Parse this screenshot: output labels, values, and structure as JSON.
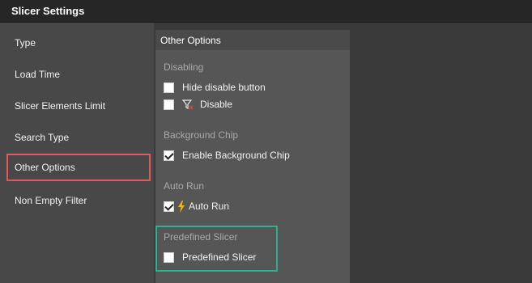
{
  "window": {
    "title": "Slicer Settings"
  },
  "sidebar": {
    "items": [
      {
        "label": "Type"
      },
      {
        "label": "Load Time"
      },
      {
        "label": "Slicer Elements Limit"
      },
      {
        "label": "Search Type"
      },
      {
        "label": "Other Options",
        "selected": true
      },
      {
        "label": "Non Empty Filter"
      }
    ]
  },
  "panel": {
    "title": "Other Options",
    "sections": [
      {
        "title": "Disabling",
        "options": [
          {
            "label": "Hide disable button",
            "checked": false
          },
          {
            "label": "Disable",
            "checked": false,
            "icon": "filter-disable-icon"
          }
        ]
      },
      {
        "title": "Background Chip",
        "options": [
          {
            "label": "Enable Background Chip",
            "checked": true
          }
        ]
      },
      {
        "title": "Auto Run",
        "options": [
          {
            "label": "Auto Run",
            "checked": true,
            "icon": "lightning-icon"
          }
        ]
      },
      {
        "title": "Predefined Slicer",
        "options": [
          {
            "label": "Predefined Slicer",
            "checked": false
          }
        ]
      }
    ]
  },
  "colors": {
    "selected_outline": "#e05a5a",
    "highlight_outline": "#2bb08f",
    "lightning": "#f5b800",
    "filter_icon_x": "#d0453c"
  }
}
